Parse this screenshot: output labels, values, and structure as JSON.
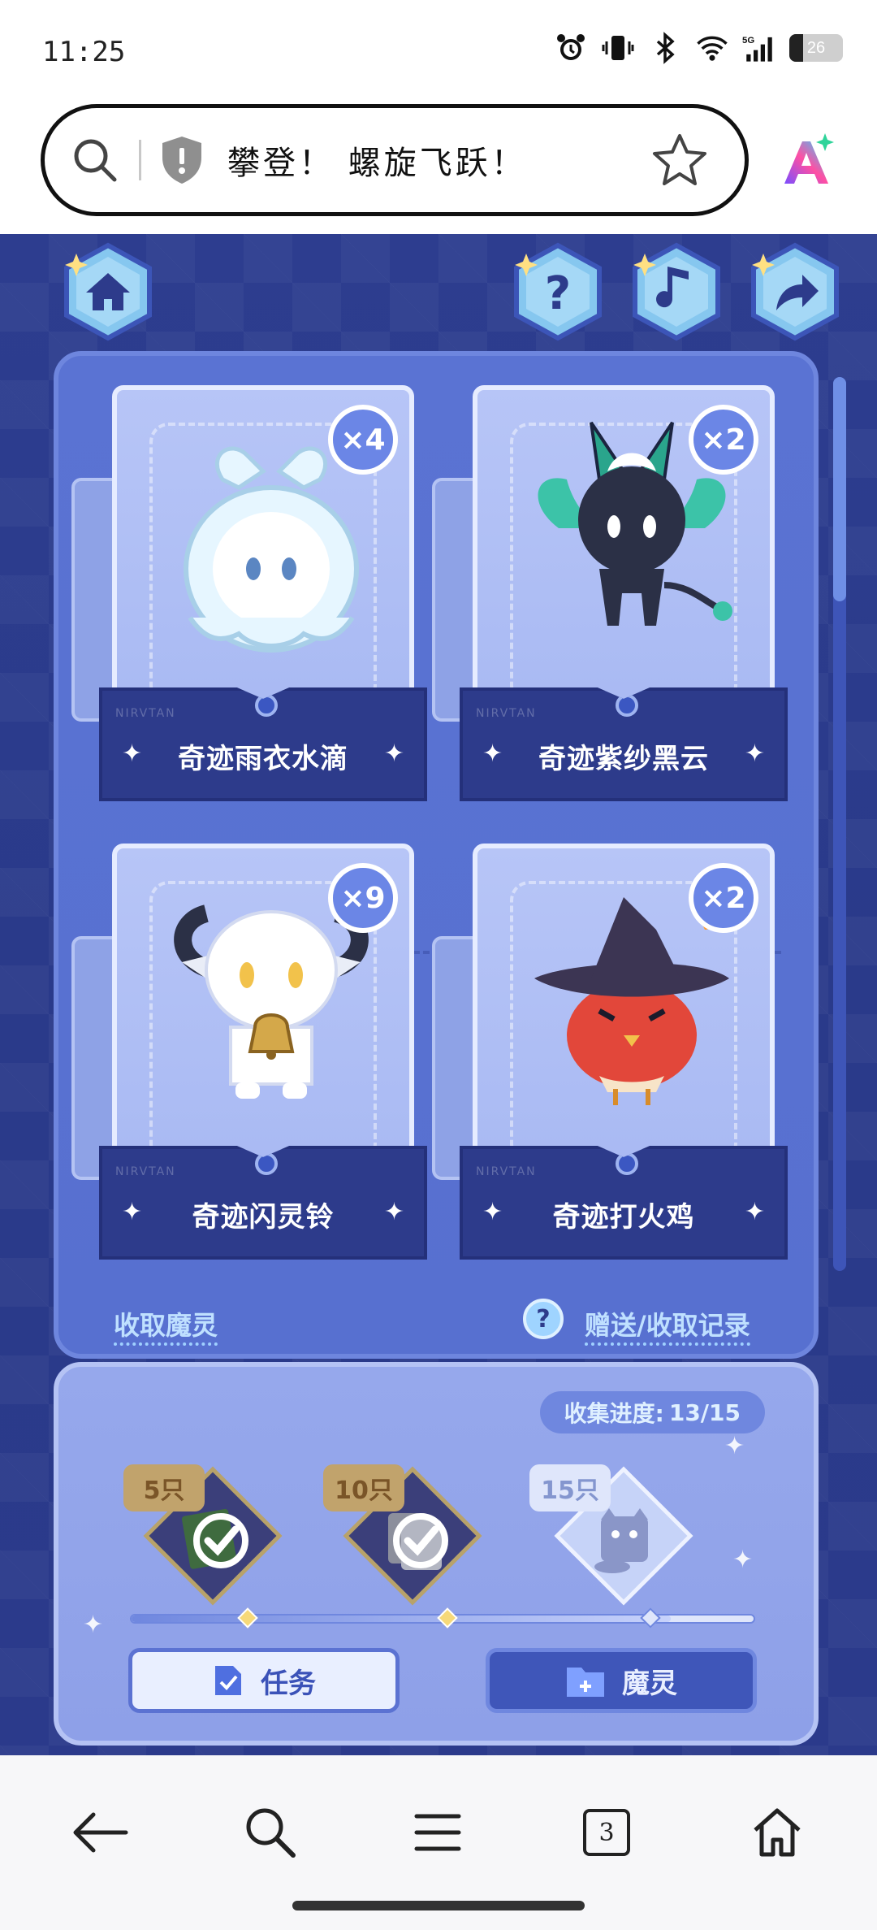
{
  "status_bar": {
    "time": "11:25",
    "battery": "26",
    "battery_level": 0.26,
    "network": "5G"
  },
  "search_bar": {
    "title": "攀登！ 螺旋飞跃！"
  },
  "game": {
    "top_buttons": [
      "home-icon",
      "help-icon",
      "music-icon",
      "share-icon"
    ],
    "cards": [
      {
        "name": "奇迹雨衣水滴",
        "count": "×4"
      },
      {
        "name": "奇迹紫纱黑云",
        "count": "×2"
      },
      {
        "name": "奇迹闪灵铃",
        "count": "×9"
      },
      {
        "name": "奇迹打火鸡",
        "count": "×2"
      }
    ],
    "link_collect": "收取魔灵",
    "help_mark": "?",
    "link_record": "赠送/收取记录",
    "collection": {
      "progress_label": "收集进度:",
      "progress_value": "13/15",
      "progress_fraction": 0.867,
      "milestones": [
        {
          "tag": "5只",
          "done": true
        },
        {
          "tag": "10只",
          "done": true
        },
        {
          "tag": "15只",
          "done": false
        }
      ],
      "task_button": "任务",
      "spirit_button": "魔灵"
    }
  },
  "bottom_nav": {
    "tabs_count": "3"
  },
  "colors": {
    "panel": "#5a73d3",
    "background": "#2b3a8b",
    "accent": "#6b86e6",
    "gold_tag": "#c1a36c"
  }
}
